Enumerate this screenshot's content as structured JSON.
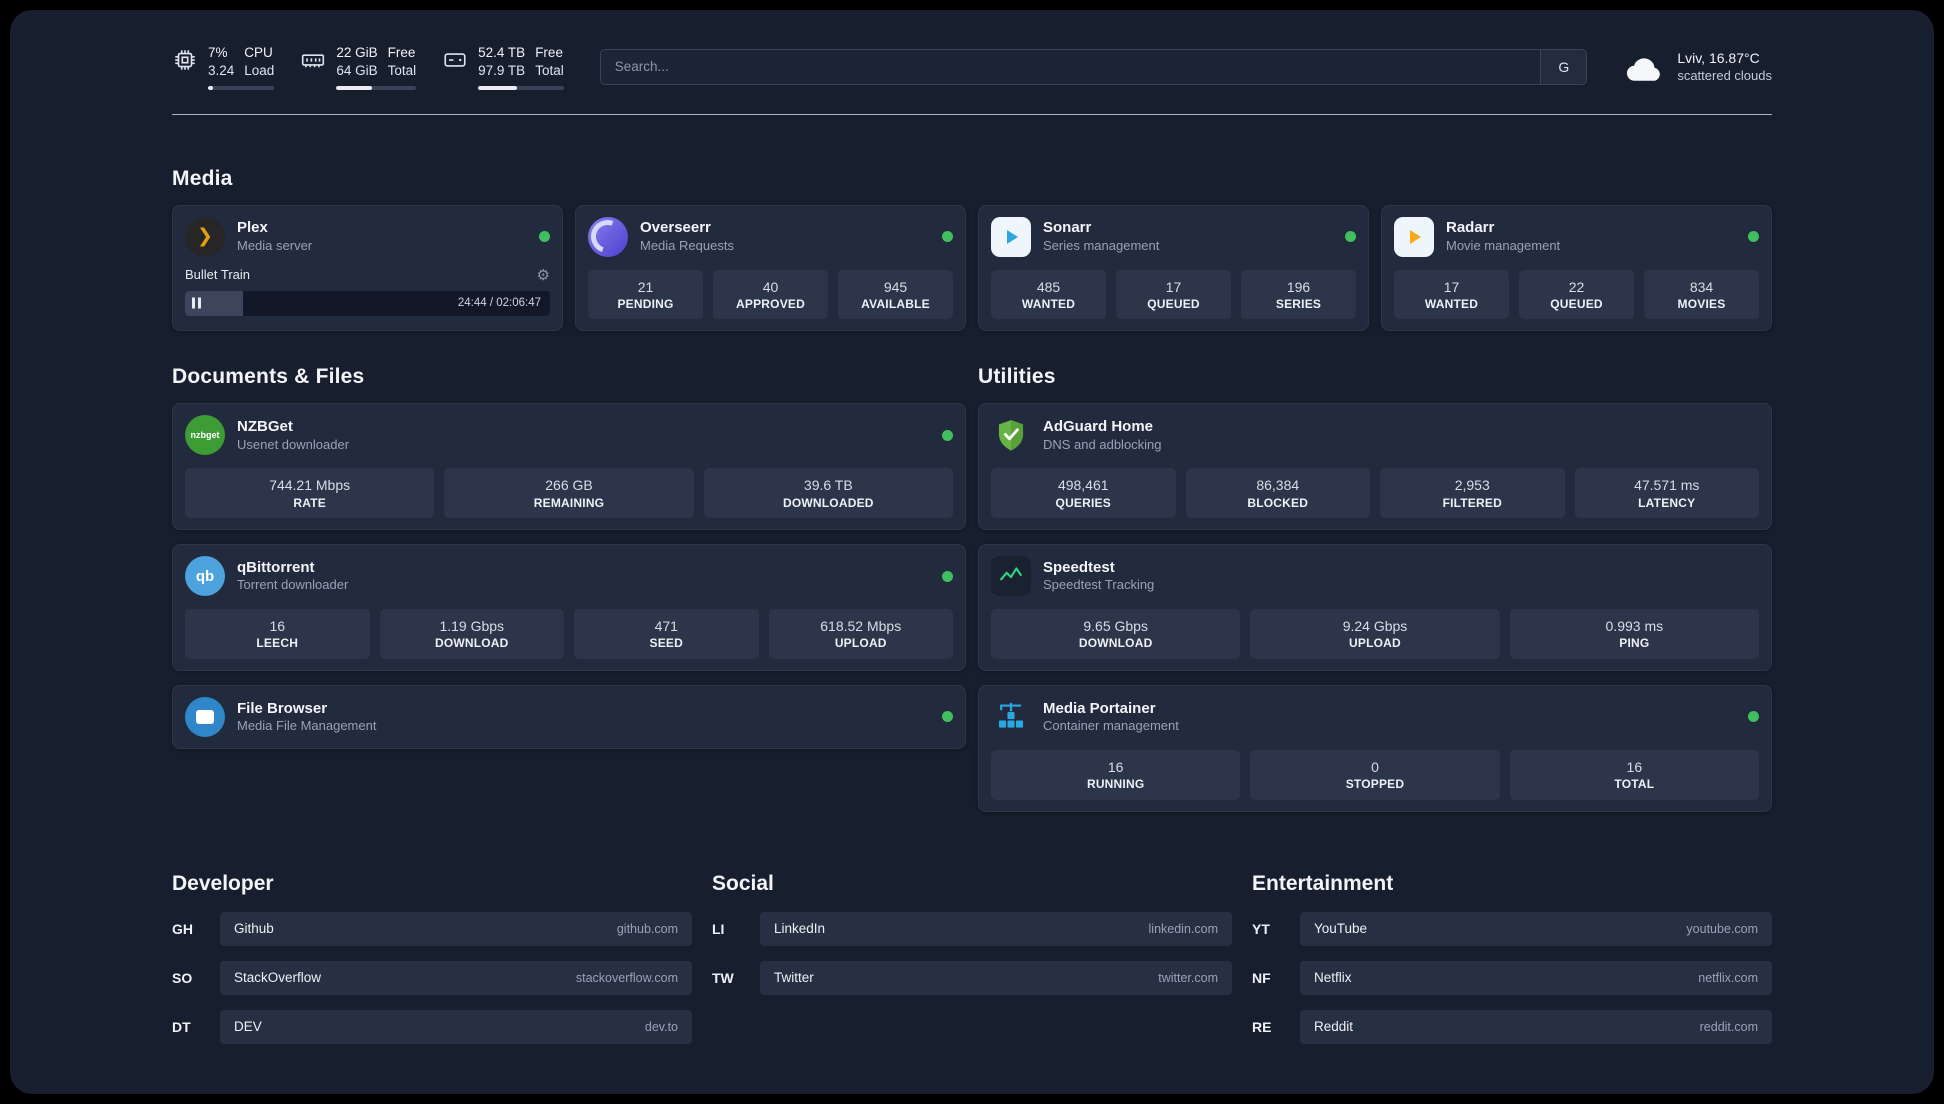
{
  "topbar": {
    "cpu": {
      "v1": "7%",
      "v2": "3.24",
      "k1": "CPU",
      "k2": "Load",
      "pct": 7
    },
    "ram": {
      "v1": "22 GiB",
      "v2": "64 GiB",
      "k1": "Free",
      "k2": "Total",
      "pct": 45
    },
    "disk": {
      "v1": "52.4 TB",
      "v2": "97.9 TB",
      "k1": "Free",
      "k2": "Total",
      "pct": 45
    },
    "search": {
      "placeholder": "Search...",
      "button": "G"
    },
    "weather": {
      "location": "Lviv, 16.87°C",
      "condition": "scattered clouds"
    }
  },
  "media": {
    "title": "Media",
    "plex": {
      "name": "Plex",
      "subtitle": "Media server",
      "icon_text": "❯",
      "track": "Bullet Train",
      "time": "24:44 / 02:06:47",
      "progress": 16
    },
    "overseerr": {
      "name": "Overseerr",
      "subtitle": "Media Requests",
      "stats": [
        {
          "v": "21",
          "l": "PENDING"
        },
        {
          "v": "40",
          "l": "APPROVED"
        },
        {
          "v": "945",
          "l": "AVAILABLE"
        }
      ]
    },
    "sonarr": {
      "name": "Sonarr",
      "subtitle": "Series management",
      "stats": [
        {
          "v": "485",
          "l": "WANTED"
        },
        {
          "v": "17",
          "l": "QUEUED"
        },
        {
          "v": "196",
          "l": "SERIES"
        }
      ]
    },
    "radarr": {
      "name": "Radarr",
      "subtitle": "Movie management",
      "stats": [
        {
          "v": "17",
          "l": "WANTED"
        },
        {
          "v": "22",
          "l": "QUEUED"
        },
        {
          "v": "834",
          "l": "MOVIES"
        }
      ]
    }
  },
  "documents": {
    "title": "Documents & Files",
    "nzbget": {
      "name": "NZBGet",
      "subtitle": "Usenet downloader",
      "icon_text": "nzbget",
      "stats": [
        {
          "v": "744.21 Mbps",
          "l": "RATE"
        },
        {
          "v": "266 GB",
          "l": "REMAINING"
        },
        {
          "v": "39.6 TB",
          "l": "DOWNLOADED"
        }
      ]
    },
    "qbittorrent": {
      "name": "qBittorrent",
      "subtitle": "Torrent downloader",
      "icon_text": "qb",
      "stats": [
        {
          "v": "16",
          "l": "LEECH"
        },
        {
          "v": "1.19 Gbps",
          "l": "DOWNLOAD"
        },
        {
          "v": "471",
          "l": "SEED"
        },
        {
          "v": "618.52 Mbps",
          "l": "UPLOAD"
        }
      ]
    },
    "filebrowser": {
      "name": "File Browser",
      "subtitle": "Media File Management"
    }
  },
  "utilities": {
    "title": "Utilities",
    "adguard": {
      "name": "AdGuard Home",
      "subtitle": "DNS and adblocking",
      "stats": [
        {
          "v": "498,461",
          "l": "QUERIES"
        },
        {
          "v": "86,384",
          "l": "BLOCKED"
        },
        {
          "v": "2,953",
          "l": "FILTERED"
        },
        {
          "v": "47.571 ms",
          "l": "LATENCY"
        }
      ]
    },
    "speedtest": {
      "name": "Speedtest",
      "subtitle": "Speedtest Tracking",
      "stats": [
        {
          "v": "9.65 Gbps",
          "l": "DOWNLOAD"
        },
        {
          "v": "9.24 Gbps",
          "l": "UPLOAD"
        },
        {
          "v": "0.993 ms",
          "l": "PING"
        }
      ]
    },
    "portainer": {
      "name": "Media Portainer",
      "subtitle": "Container management",
      "stats": [
        {
          "v": "16",
          "l": "RUNNING"
        },
        {
          "v": "0",
          "l": "STOPPED"
        },
        {
          "v": "16",
          "l": "TOTAL"
        }
      ]
    }
  },
  "bookmarks": {
    "developer": {
      "title": "Developer",
      "items": [
        {
          "abbr": "GH",
          "name": "Github",
          "url": "github.com"
        },
        {
          "abbr": "SO",
          "name": "StackOverflow",
          "url": "stackoverflow.com"
        },
        {
          "abbr": "DT",
          "name": "DEV",
          "url": "dev.to"
        }
      ]
    },
    "social": {
      "title": "Social",
      "items": [
        {
          "abbr": "LI",
          "name": "LinkedIn",
          "url": "linkedin.com"
        },
        {
          "abbr": "TW",
          "name": "Twitter",
          "url": "twitter.com"
        }
      ]
    },
    "entertainment": {
      "title": "Entertainment",
      "items": [
        {
          "abbr": "YT",
          "name": "YouTube",
          "url": "youtube.com"
        },
        {
          "abbr": "NF",
          "name": "Netflix",
          "url": "netflix.com"
        },
        {
          "abbr": "RE",
          "name": "Reddit",
          "url": "reddit.com"
        }
      ]
    }
  }
}
